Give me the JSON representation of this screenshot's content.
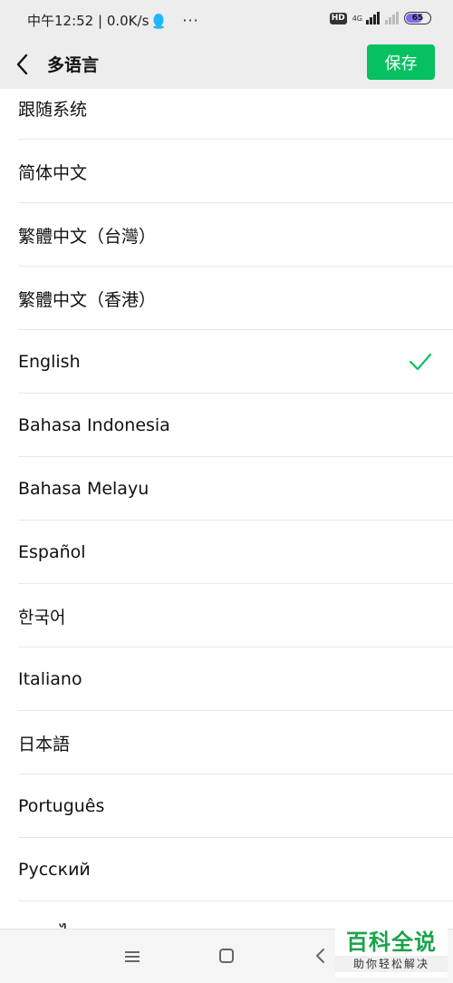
{
  "status_bar": {
    "time": "中午12:52",
    "network_speed": "0.0K/s",
    "more": "···",
    "hd": "HD",
    "network_type": "4G",
    "battery": "65",
    "icons": [
      "qq-icon",
      "signal-icon",
      "battery-icon"
    ]
  },
  "header": {
    "title": "多语言",
    "save_label": "保存",
    "back_icon": "chevron-left-icon"
  },
  "languages": [
    "跟随系统",
    "简体中文",
    "繁體中文（台灣）",
    "繁體中文（香港）",
    "English",
    "Bahasa Indonesia",
    "Bahasa Melayu",
    "Español",
    "한국어",
    "Italiano",
    "日本語",
    "Português",
    "Русский",
    "ภาษาไทย"
  ],
  "selected_language": "English",
  "colors": {
    "accent": "#07c160",
    "background": "#ededed",
    "list_bg": "#ffffff",
    "watermark_green": "#1aa34a"
  },
  "bottom_nav": {
    "icons": [
      "menu-icon",
      "home-icon",
      "back-icon"
    ]
  },
  "watermark": {
    "title": "百科全说",
    "subtitle": "助你轻松解决"
  }
}
